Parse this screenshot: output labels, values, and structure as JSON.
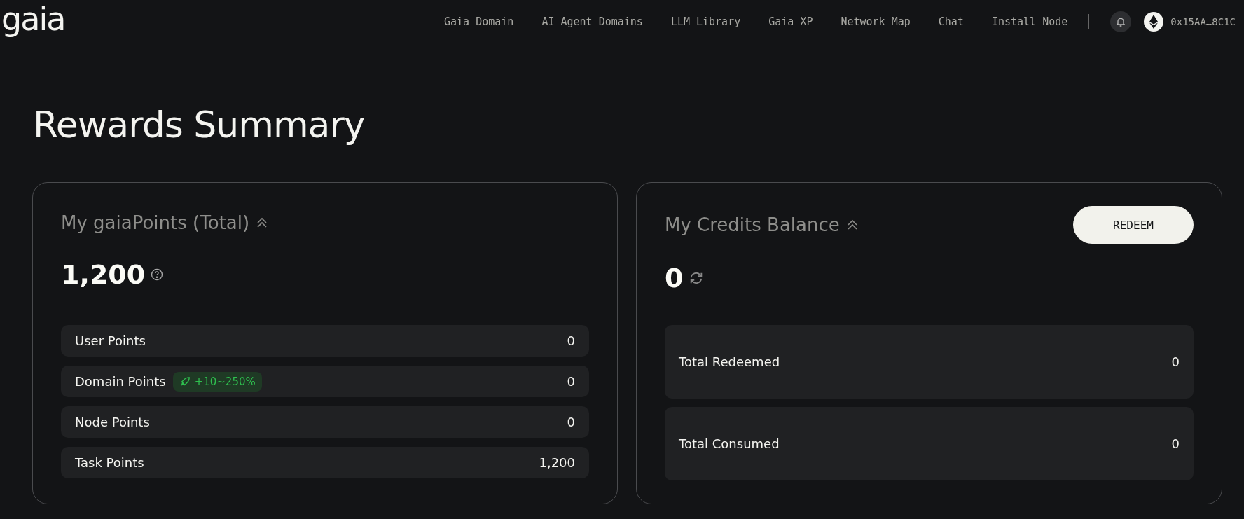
{
  "header": {
    "logo": "gaia",
    "nav": [
      "Gaia Domain",
      "AI Agent Domains",
      "LLM Library",
      "Gaia XP",
      "Network Map",
      "Chat",
      "Install Node"
    ],
    "wallet": "0x15AA…8C1C"
  },
  "title": "Rewards Summary",
  "points_card": {
    "heading": "My gaiaPoints (Total)",
    "total": "1,200",
    "rows": [
      {
        "label": "User Points",
        "value": "0"
      },
      {
        "label": "Domain Points",
        "value": "0",
        "badge": "+10~250%"
      },
      {
        "label": "Node Points",
        "value": "0"
      },
      {
        "label": "Task Points",
        "value": "1,200"
      }
    ]
  },
  "credits_card": {
    "heading": "My Credits Balance",
    "total": "0",
    "button": "REDEEM",
    "rows": [
      {
        "label": "Total Redeemed",
        "value": "0"
      },
      {
        "label": "Total Consumed",
        "value": "0"
      }
    ]
  }
}
